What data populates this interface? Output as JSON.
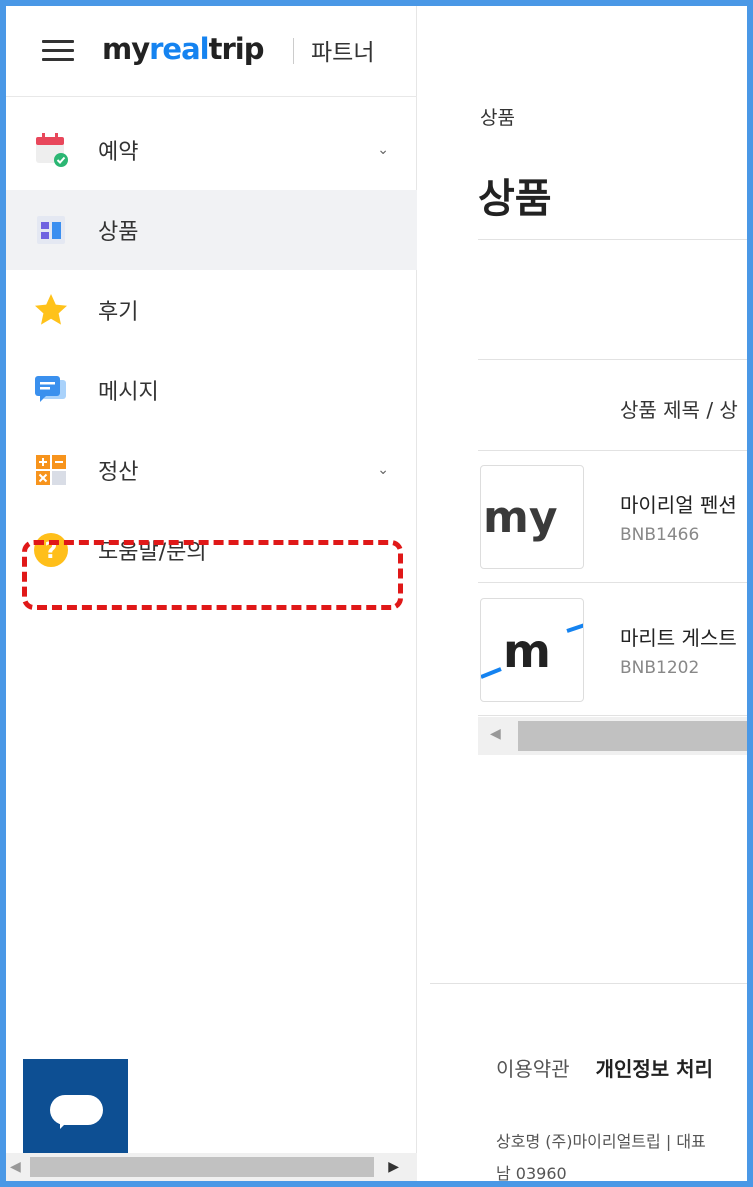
{
  "header": {
    "brand_prefix": "my",
    "brand_accent": "real",
    "brand_suffix": "trip",
    "partner_label": "파트너",
    "brand_color": "#1583f0"
  },
  "sidebar": {
    "items": [
      {
        "label": "예약",
        "icon": "calendar-check-icon",
        "has_chevron": true
      },
      {
        "label": "상품",
        "icon": "product-grid-icon",
        "active": true
      },
      {
        "label": "후기",
        "icon": "star-icon"
      },
      {
        "label": "메시지",
        "icon": "message-bubble-icon"
      },
      {
        "label": "정산",
        "icon": "calculator-icon",
        "has_chevron": true
      },
      {
        "label": "도움말/문의",
        "icon": "help-question-icon",
        "highlighted": true
      }
    ],
    "chevron": "⌄"
  },
  "main": {
    "breadcrumb": "상품",
    "title": "상품",
    "column_header": "상품 제목 / 상",
    "rows": [
      {
        "title": "마이리얼 펜션",
        "code": "BNB1466",
        "thumb_text": "my"
      },
      {
        "title": "마리트 게스트",
        "code": "BNB1202",
        "thumb_text": "m"
      }
    ]
  },
  "footer": {
    "terms": "이용약관",
    "privacy": "개인정보 처리",
    "company_info": "상호명 (주)마이리얼트립 | 대표",
    "address": "남 03960"
  },
  "colors": {
    "frame": "#4a98e6",
    "active_bg": "#f1f2f4",
    "highlight_border": "#e01818",
    "chat_button": "#0d4f93"
  }
}
